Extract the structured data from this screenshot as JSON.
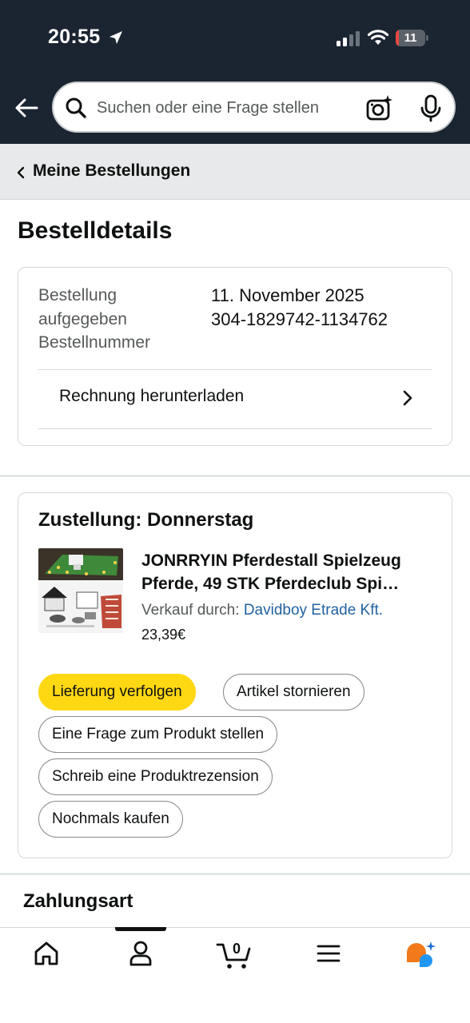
{
  "status_bar": {
    "time": "20:55",
    "battery": "11",
    "battery_level": 0.11
  },
  "search": {
    "placeholder": "Suchen oder eine Frage stellen"
  },
  "breadcrumb": {
    "label": "Meine Bestellungen"
  },
  "page": {
    "title": "Bestelldetails"
  },
  "order_info": {
    "placed_label": "Bestellung aufgegeben",
    "placed_value": "11. November 2025",
    "number_label": "Bestellnummer",
    "number_value": "304-1829742-1134762",
    "invoice_label": "Rechnung herunterladen"
  },
  "delivery": {
    "title": "Zustellung: Donnerstag",
    "product": {
      "title_line1": "JONRRYIN Pferdestall Spielzeug",
      "title_line2": "Pferde, 49 STK Pferdeclub Spi…",
      "sold_by_label": "Verkauf durch:",
      "seller": "Davidboy Etrade Kft.",
      "price": "23,39€"
    },
    "actions": {
      "track": "Lieferung verfolgen",
      "cancel": "Artikel stornieren",
      "ask": "Eine Frage zum Produkt stellen",
      "review": "Schreib eine Produktrezension",
      "buy_again": "Nochmals kaufen"
    }
  },
  "payment": {
    "title": "Zahlungsart"
  },
  "bottom_nav": {
    "items": [
      "home-icon",
      "account-icon",
      "cart-icon",
      "menu-icon",
      "rufus-icon"
    ],
    "cart_count": "0"
  },
  "colors": {
    "header_bg": "#1b2531",
    "primary_button": "#ffd814",
    "link": "#2162a1"
  }
}
